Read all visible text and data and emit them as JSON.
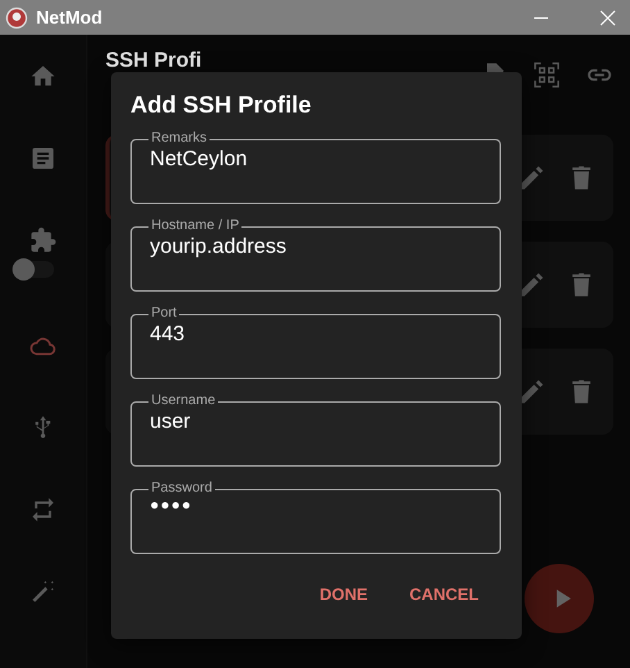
{
  "window": {
    "title": "NetMod"
  },
  "sidebar": {
    "items": [
      {
        "kind": "home",
        "selected": false
      },
      {
        "kind": "notes",
        "selected": false
      },
      {
        "kind": "puzzle",
        "selected": false
      },
      {
        "kind": "cloud",
        "selected": true
      },
      {
        "kind": "usb",
        "selected": false
      },
      {
        "kind": "repeat",
        "selected": false
      },
      {
        "kind": "wand",
        "selected": false
      }
    ],
    "toggle": {
      "on": false
    }
  },
  "page": {
    "title": "SSH Profi"
  },
  "profiles": [
    {
      "selected": true
    },
    {
      "selected": false
    },
    {
      "selected": false
    }
  ],
  "dialog": {
    "title": "Add SSH Profile",
    "fields": [
      {
        "label": "Remarks",
        "value": "NetCeylon",
        "kind": "text"
      },
      {
        "label": "Hostname / IP",
        "value": "yourip.address",
        "kind": "text"
      },
      {
        "label": "Port",
        "value": "443",
        "kind": "text"
      },
      {
        "label": "Username",
        "value": "user",
        "kind": "text"
      },
      {
        "label": "Password",
        "value": "●●●●",
        "kind": "password"
      }
    ],
    "buttons": [
      "DONE",
      "CANCEL"
    ]
  }
}
